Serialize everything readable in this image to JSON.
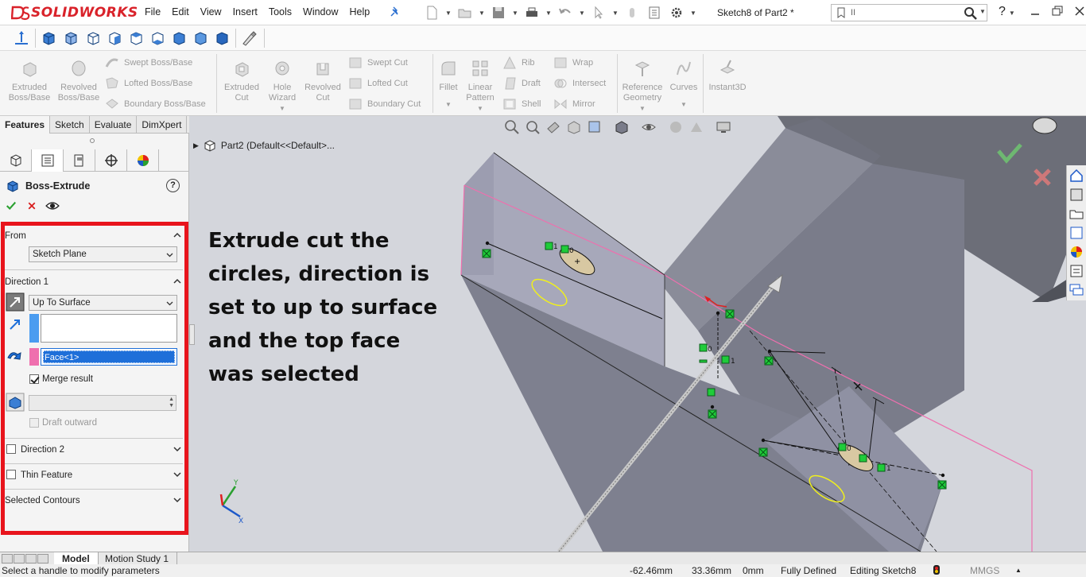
{
  "app": {
    "brand": "SOLIDWORKS",
    "document_title": "Sketch8 of Part2 *",
    "menus": [
      "File",
      "Edit",
      "View",
      "Insert",
      "Tools",
      "Window",
      "Help"
    ],
    "search_value": "II",
    "help_label": "?"
  },
  "command_manager": {
    "features": [
      {
        "label": "Extruded\nBoss/Base",
        "icon": "extruded-boss-icon"
      },
      {
        "label": "Revolved\nBoss/Base",
        "icon": "revolved-boss-icon"
      },
      {
        "label": "Swept Boss/Base",
        "icon": "swept-boss-icon"
      },
      {
        "label": "Lofted Boss/Base",
        "icon": "lofted-boss-icon"
      },
      {
        "label": "Boundary Boss/Base",
        "icon": "boundary-boss-icon"
      },
      {
        "label": "Extruded\nCut",
        "icon": "extruded-cut-icon"
      },
      {
        "label": "Hole\nWizard",
        "icon": "hole-wizard-icon"
      },
      {
        "label": "Revolved\nCut",
        "icon": "revolved-cut-icon"
      },
      {
        "label": "Swept Cut",
        "icon": "swept-cut-icon"
      },
      {
        "label": "Lofted Cut",
        "icon": "lofted-cut-icon"
      },
      {
        "label": "Boundary Cut",
        "icon": "boundary-cut-icon"
      },
      {
        "label": "Fillet",
        "icon": "fillet-icon"
      },
      {
        "label": "Linear\nPattern",
        "icon": "linear-pattern-icon"
      },
      {
        "label": "Rib",
        "icon": "rib-icon"
      },
      {
        "label": "Draft",
        "icon": "draft-icon"
      },
      {
        "label": "Shell",
        "icon": "shell-icon"
      },
      {
        "label": "Wrap",
        "icon": "wrap-icon"
      },
      {
        "label": "Intersect",
        "icon": "intersect-icon"
      },
      {
        "label": "Mirror",
        "icon": "mirror-icon"
      },
      {
        "label": "Reference\nGeometry",
        "icon": "reference-geometry-icon"
      },
      {
        "label": "Curves",
        "icon": "curves-icon"
      },
      {
        "label": "Instant3D",
        "icon": "instant3d-icon"
      }
    ]
  },
  "left_panel": {
    "tabs": [
      "Features",
      "Sketch",
      "Evaluate",
      "DimXpert"
    ],
    "active_tab": "Features",
    "feature_title": "Boss-Extrude",
    "from": {
      "header": "From",
      "value": "Sketch Plane"
    },
    "direction1": {
      "header": "Direction 1",
      "end_condition": "Up To Surface",
      "face_value": "Face<1>",
      "merge_result_label": "Merge result",
      "merge_result_checked": true,
      "draft_outward_label": "Draft outward"
    },
    "direction2_label": "Direction 2",
    "thin_feature_label": "Thin Feature",
    "selected_contours_label": "Selected Contours"
  },
  "graphics": {
    "tree_breadcrumb": "Part2  (Default<<Default>...",
    "annotation": "Extrude cut the circles, direction is set to up to surface and the top face was selected",
    "triad_labels": {
      "y": "Y",
      "x": "X"
    }
  },
  "bottom_tabs": [
    "Model",
    "Motion Study 1"
  ],
  "status": {
    "message": "Select a handle to modify parameters",
    "x": "-62.46mm",
    "y": "33.36mm",
    "z": "0mm",
    "state": "Fully Defined",
    "editing": "Editing Sketch8",
    "units": "MMGS"
  },
  "colors": {
    "brand_red": "#d9222a",
    "highlight_red": "#e8141c",
    "selection_blue": "#1e6fd9",
    "face_pink": "#ef6fae",
    "relation_green": "#1fcc3a"
  }
}
